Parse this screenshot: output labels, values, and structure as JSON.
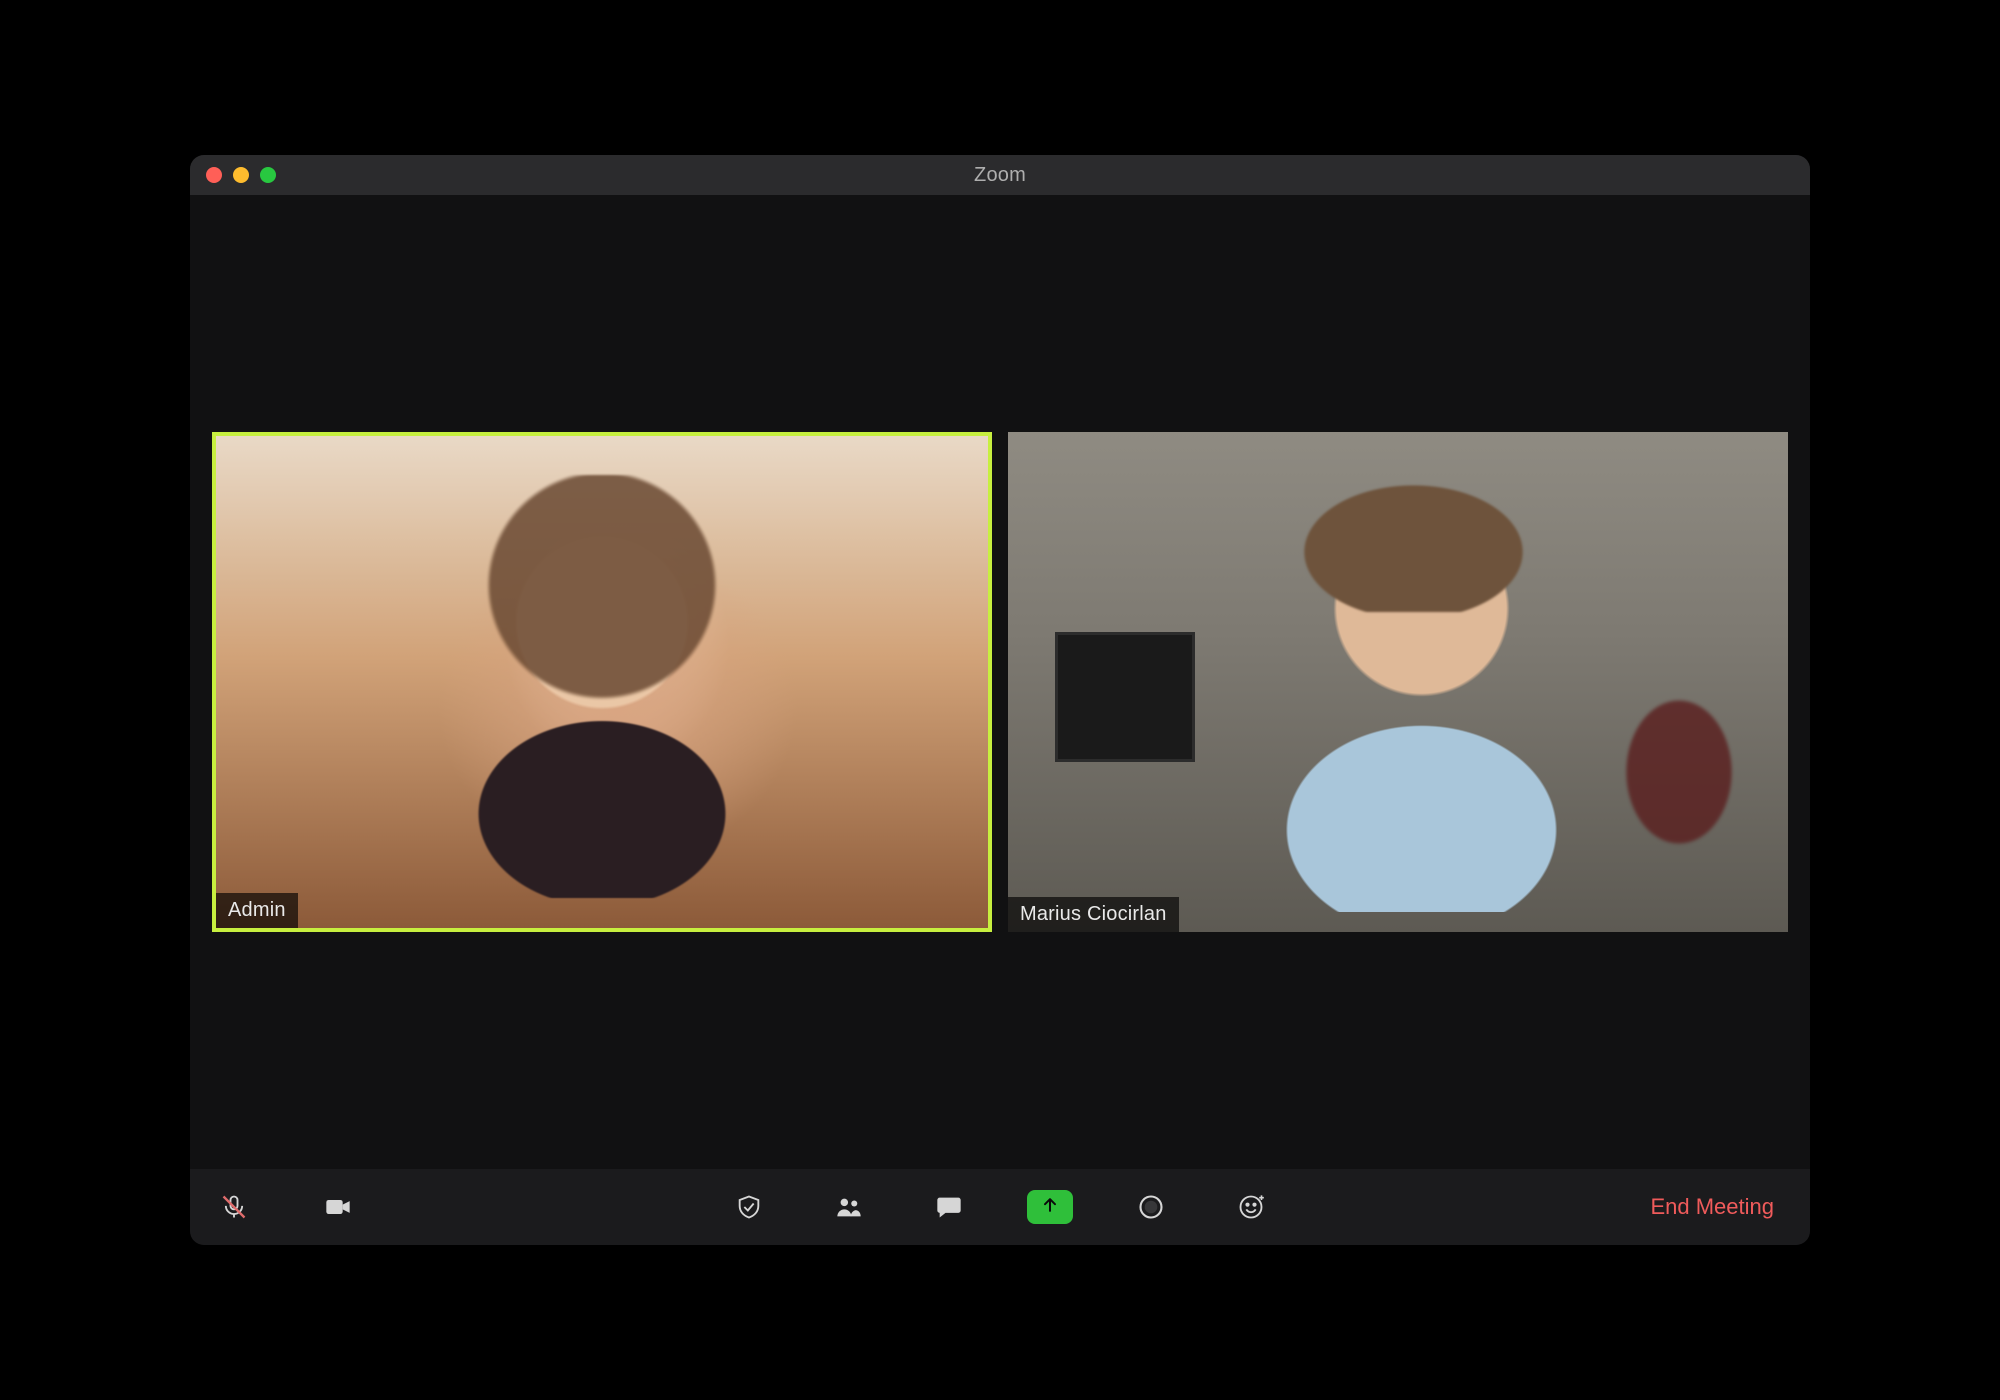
{
  "window": {
    "title": "Zoom"
  },
  "participants": [
    {
      "name": "Admin",
      "active_speaker": true
    },
    {
      "name": "Marius Ciocirlan",
      "active_speaker": false
    }
  ],
  "toolbar": {
    "mute_icon": "microphone-muted-icon",
    "video_icon": "video-icon",
    "security_icon": "shield-icon",
    "participants_icon": "participants-icon",
    "chat_icon": "chat-icon",
    "share_icon": "share-screen-icon",
    "record_icon": "record-icon",
    "reactions_icon": "reactions-icon",
    "end_label": "End Meeting"
  },
  "colors": {
    "active_border": "#c7ef3f",
    "share_green": "#2fbf3a",
    "end_red": "#f05b5b"
  }
}
